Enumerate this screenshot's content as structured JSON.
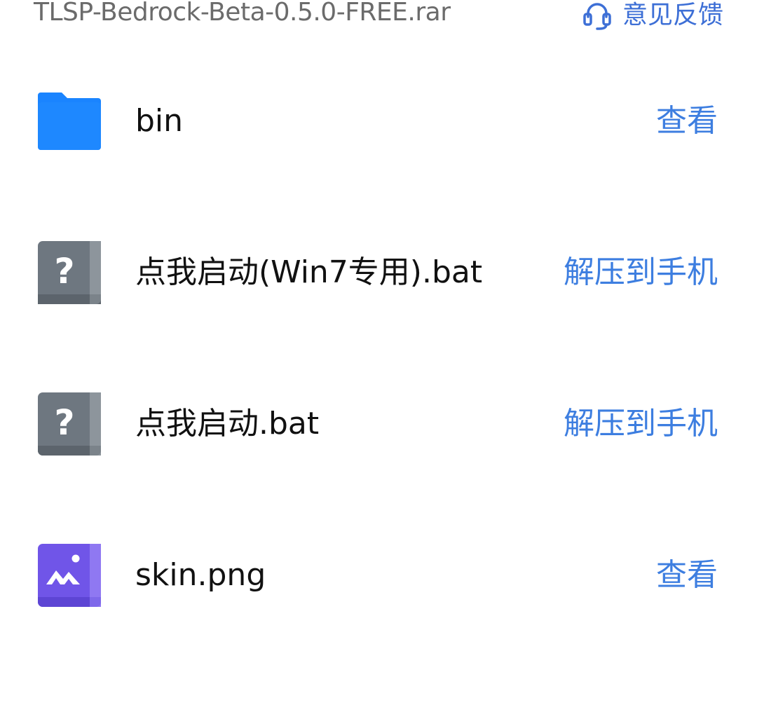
{
  "header": {
    "archive_name": "TLSP-Bedrock-Beta-0.5.0-FREE.rar",
    "feedback_label": "意见反馈",
    "feedback_icon": "headset-icon"
  },
  "colors": {
    "accent": "#3d7ee0",
    "folder": "#1a84ff",
    "unknown_file": "#6e7780",
    "image_file": "#7055e8"
  },
  "files": [
    {
      "name": "bin",
      "icon": "folder-icon",
      "action": "查看"
    },
    {
      "name": "点我启动(Win7专用).bat",
      "icon": "unknown-file-icon",
      "action": "解压到手机"
    },
    {
      "name": "点我启动.bat",
      "icon": "unknown-file-icon",
      "action": "解压到手机"
    },
    {
      "name": "skin.png",
      "icon": "image-file-icon",
      "action": "查看"
    }
  ]
}
